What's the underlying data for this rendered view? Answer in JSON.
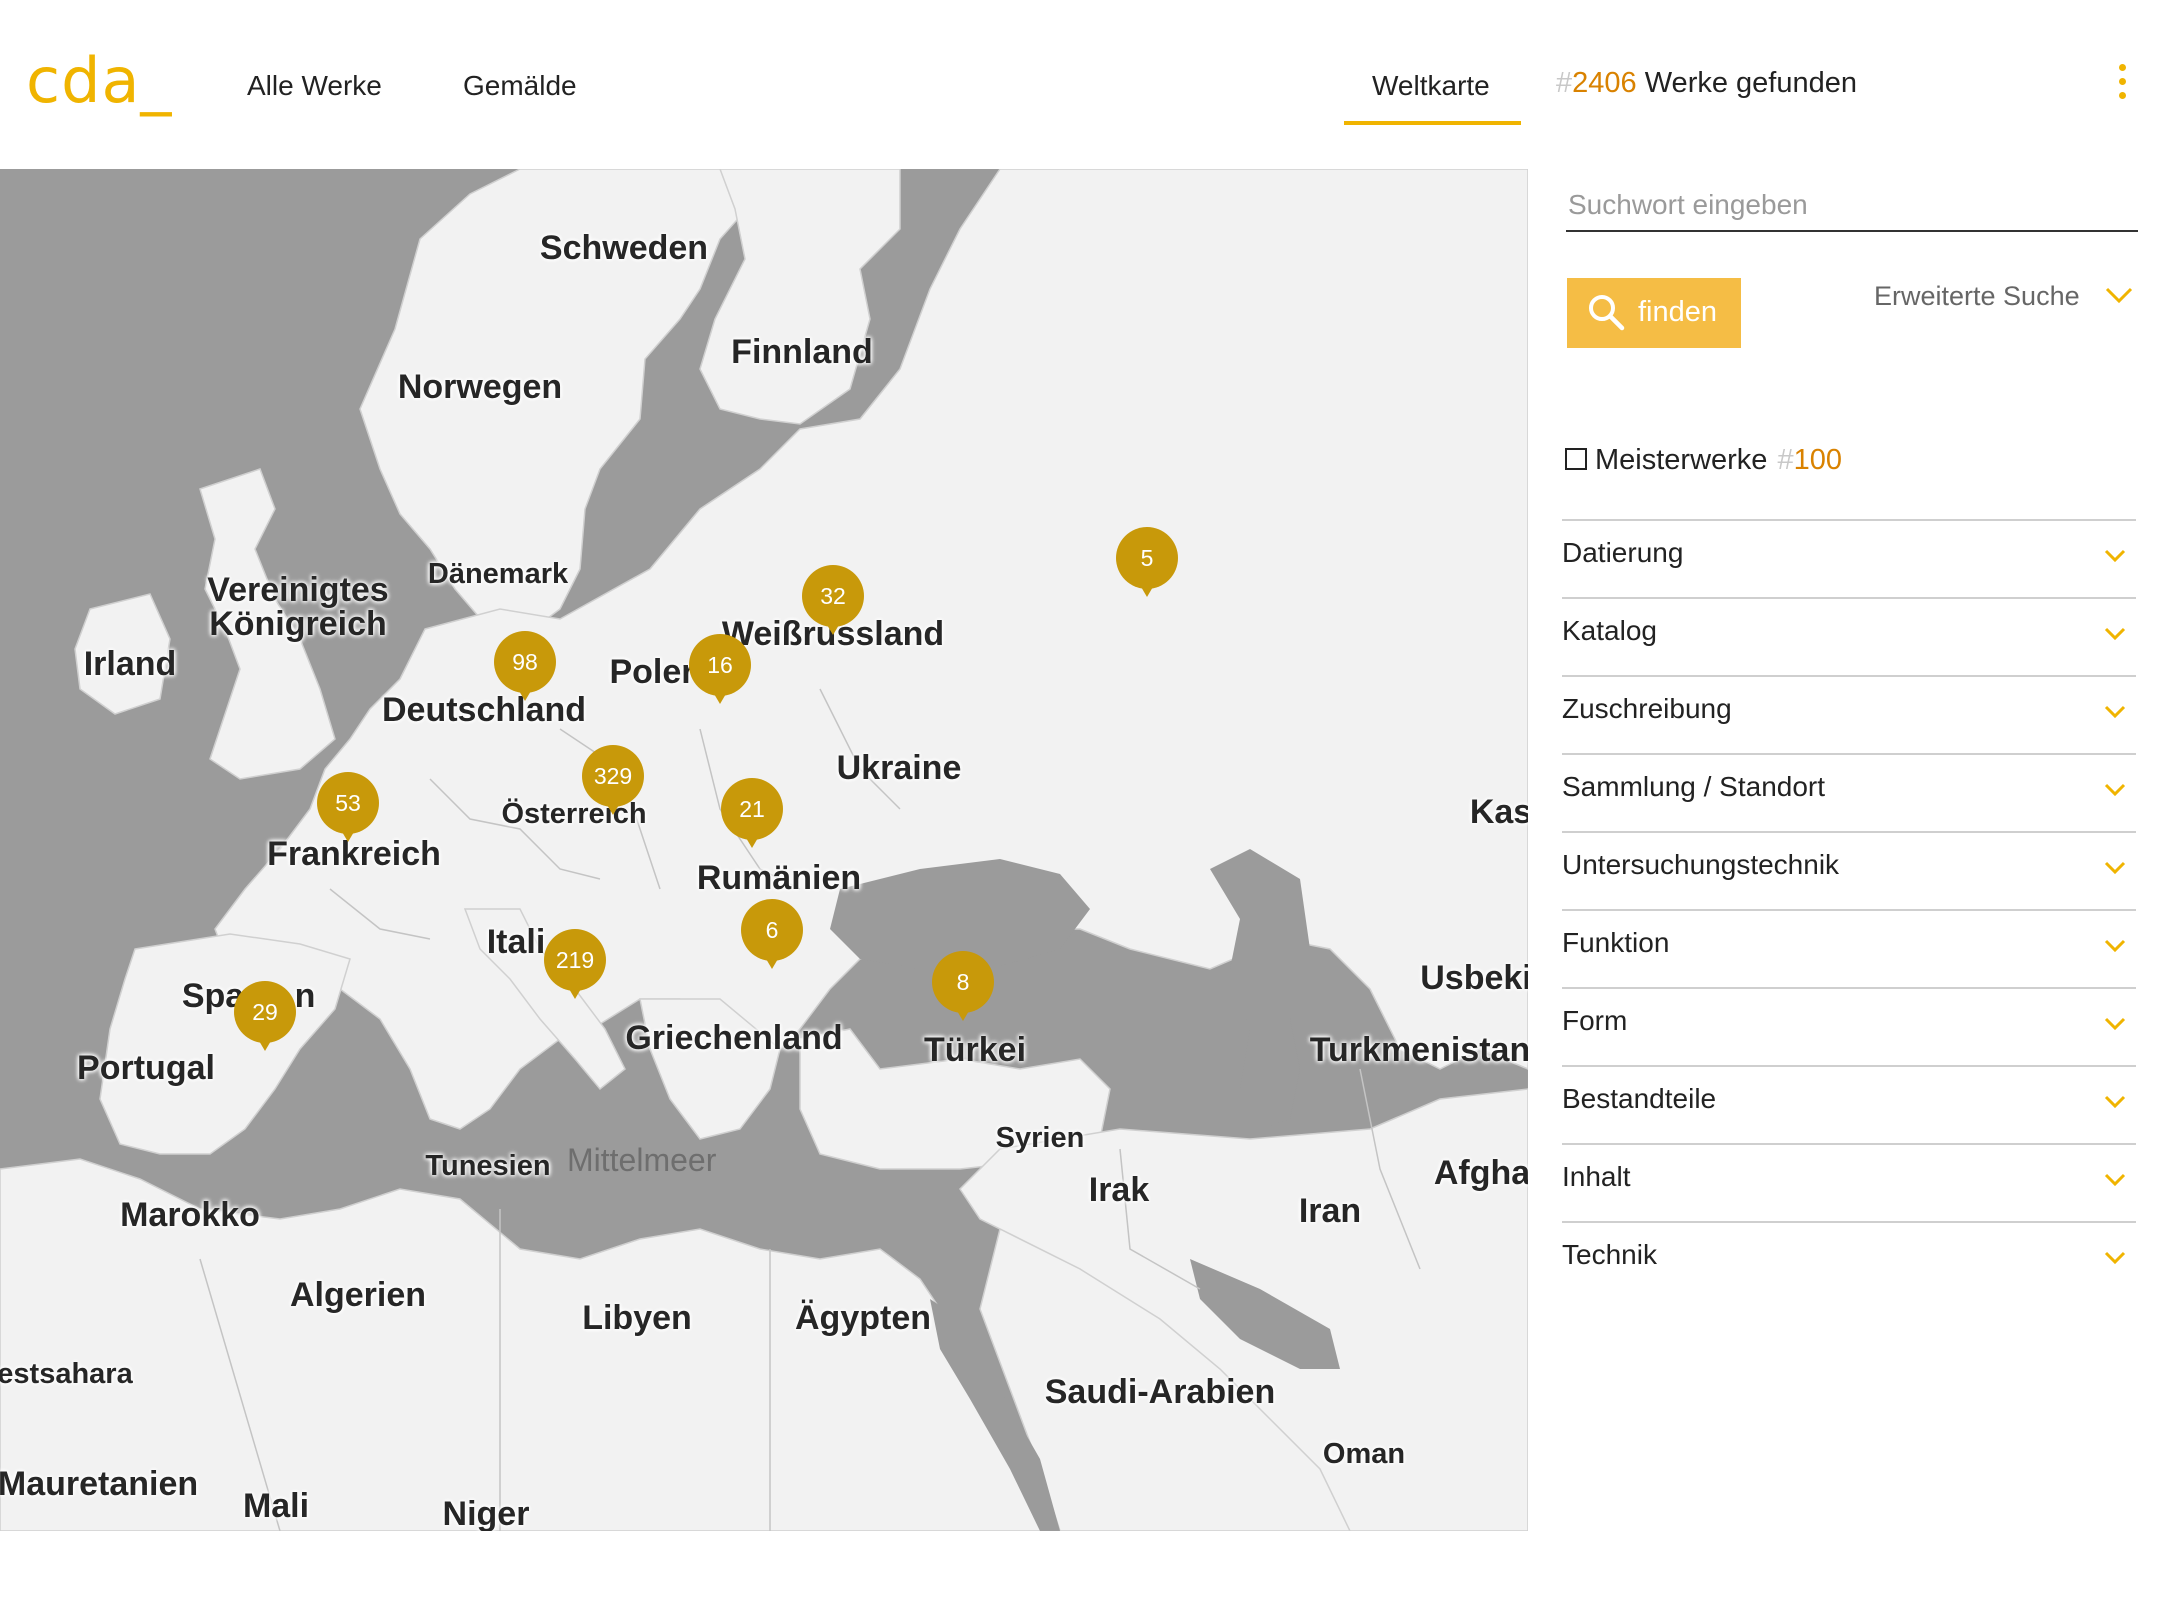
{
  "header": {
    "logo": "cda_",
    "nav": [
      {
        "label": "Alle Werke"
      },
      {
        "label": "Gemälde"
      },
      {
        "label": "Weltkarte",
        "active": true
      }
    ],
    "results": {
      "hash": "#",
      "count": "2406",
      "suffix": " Werke gefunden"
    }
  },
  "map": {
    "countries": [
      "Schweden",
      "Finnland",
      "Norwegen",
      "Dänemark",
      "Vereinigtes",
      "Königreich",
      "Irland",
      "Weißrussland",
      "Poler",
      "Deutschland",
      "Ukraine",
      "Österreich",
      "Frankreich",
      "Rumänien",
      "Kas",
      "Itali",
      "Spa",
      "n",
      "Portugal",
      "Griechenland",
      "Türkei",
      "Usbeki",
      "Turkmenistan",
      "Syrien",
      "Tunesien",
      "Irak",
      "Iran",
      "Afgha",
      "Marokko",
      "Algerien",
      "Libyen",
      "Ägypten",
      "Saudi-Arabien",
      "Oman",
      "estsahara",
      "Mauretanien",
      "Mali",
      "Niger"
    ],
    "sea": "Mittelmeer",
    "markers": [
      {
        "count": "5"
      },
      {
        "count": "32"
      },
      {
        "count": "98"
      },
      {
        "count": "16"
      },
      {
        "count": "329"
      },
      {
        "count": "53"
      },
      {
        "count": "21"
      },
      {
        "count": "6"
      },
      {
        "count": "219"
      },
      {
        "count": "8"
      },
      {
        "count": "29"
      }
    ],
    "colors": {
      "land": "#f2f2f2",
      "water": "#9b9b9b",
      "marker": "#c8990a"
    }
  },
  "sidebar": {
    "search_placeholder": "Suchwort eingeben",
    "find_label": "finden",
    "advanced_label": "Erweiterte Suche",
    "masterworks": {
      "label": "Meisterwerke",
      "hash": "#",
      "count": "100",
      "checked": false
    },
    "facets": [
      {
        "label": "Datierung"
      },
      {
        "label": "Katalog"
      },
      {
        "label": "Zuschreibung"
      },
      {
        "label": "Sammlung / Standort"
      },
      {
        "label": "Untersuchungstechnik"
      },
      {
        "label": "Funktion"
      },
      {
        "label": "Form"
      },
      {
        "label": "Bestandteile"
      },
      {
        "label": "Inhalt"
      },
      {
        "label": "Technik"
      }
    ]
  },
  "colors": {
    "accent": "#f0b400",
    "count_orange": "#d98200",
    "button": "#f5bd45"
  }
}
